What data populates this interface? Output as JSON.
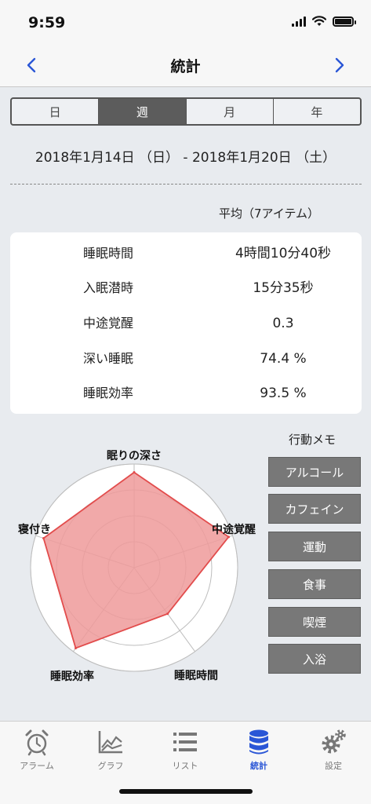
{
  "status_bar": {
    "time": "9:59"
  },
  "nav": {
    "title": "統計",
    "back_icon": "chevron-left-icon",
    "forward_icon": "chevron-right-icon"
  },
  "segments": [
    {
      "label": "日",
      "active": false
    },
    {
      "label": "週",
      "active": true
    },
    {
      "label": "月",
      "active": false
    },
    {
      "label": "年",
      "active": false
    }
  ],
  "date_range": "2018年1月14日 （日） - 2018年1月20日 （土）",
  "average_label": "平均（7アイテム）",
  "stats": [
    {
      "label": "睡眠時間",
      "value": "4時間10分40秒"
    },
    {
      "label": "入眠潜時",
      "value": "15分35秒"
    },
    {
      "label": "中途覚醒",
      "value": "0.3"
    },
    {
      "label": "深い睡眠",
      "value": "74.4 %"
    },
    {
      "label": "睡眠効率",
      "value": "93.5 %"
    }
  ],
  "chart_data": {
    "type": "radar",
    "axes": [
      "眠りの深さ",
      "中途覚醒",
      "睡眠時間",
      "睡眠効率",
      "寝付き"
    ],
    "values": [
      0.92,
      0.96,
      0.55,
      0.96,
      0.92
    ],
    "range": [
      0,
      1
    ],
    "rings": 4,
    "fill_color": "#ee9a9a",
    "line_color": "#e24c4c"
  },
  "memo": {
    "title": "行動メモ",
    "items": [
      "アルコール",
      "カフェイン",
      "運動",
      "食事",
      "喫煙",
      "入浴"
    ]
  },
  "tabs": [
    {
      "label": "アラーム",
      "icon": "alarm-clock-icon",
      "active": false
    },
    {
      "label": "グラフ",
      "icon": "line-graph-icon",
      "active": false
    },
    {
      "label": "リスト",
      "icon": "list-icon",
      "active": false
    },
    {
      "label": "統計",
      "icon": "database-icon",
      "active": true
    },
    {
      "label": "設定",
      "icon": "gear-icon",
      "active": false
    }
  ],
  "colors": {
    "accent": "#2a56d6",
    "segment_active": "#5c5c5c",
    "memo_button": "#787878"
  }
}
